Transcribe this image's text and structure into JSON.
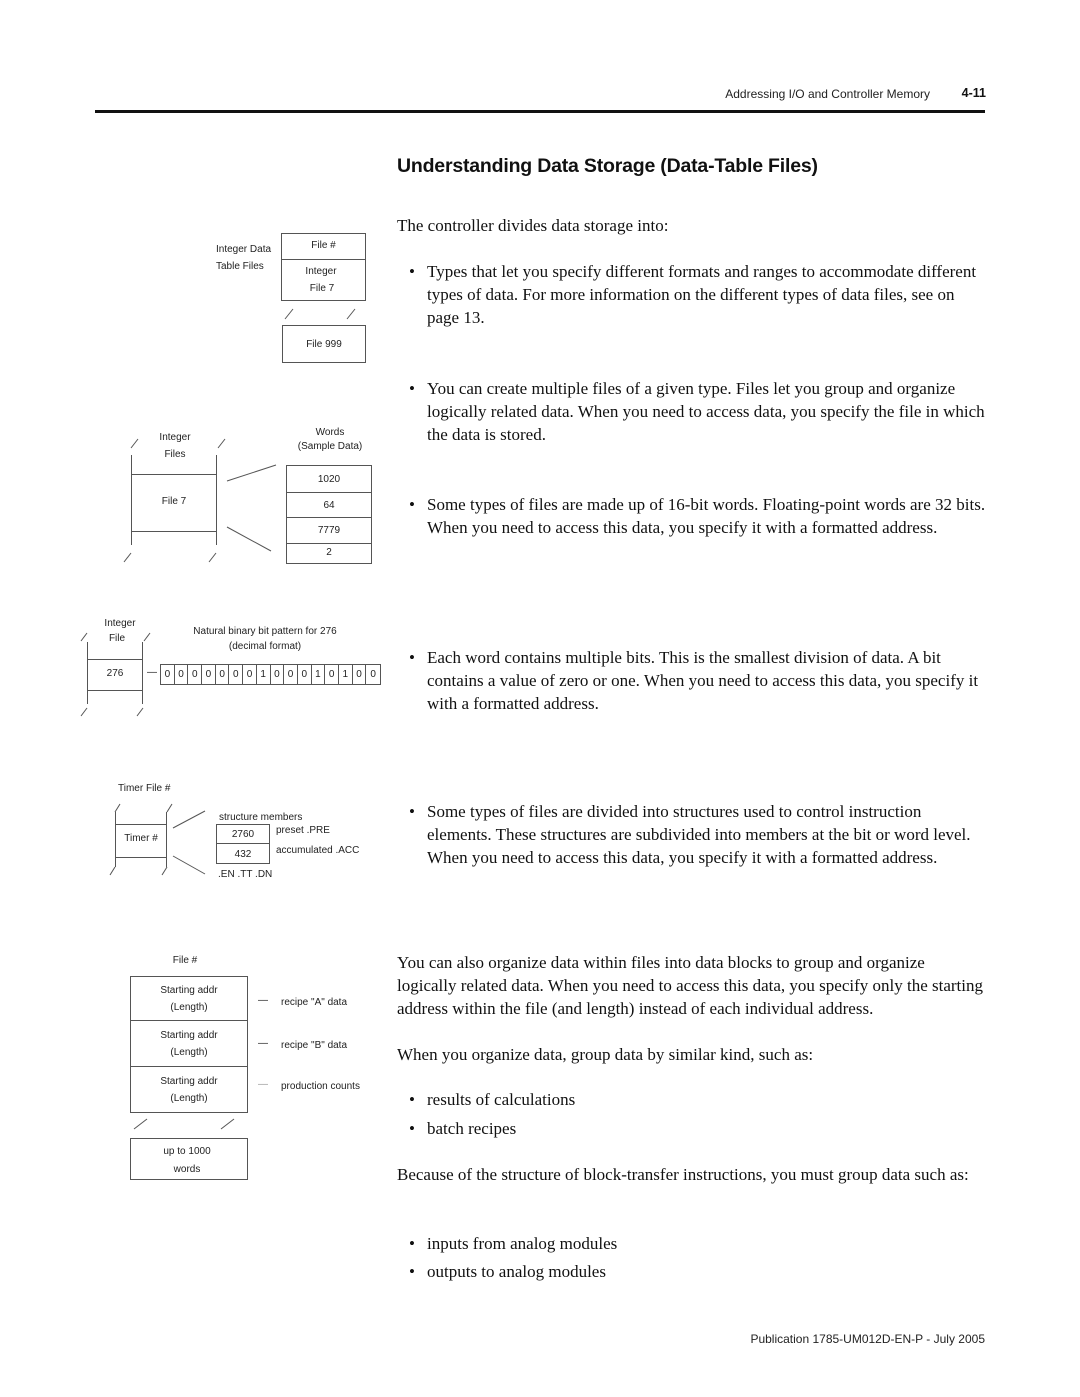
{
  "header": {
    "running_title": "Addressing I/O and Controller Memory",
    "page_number": "4-11"
  },
  "section": {
    "title": "Understanding Data Storage (Data-Table Files)"
  },
  "body": {
    "intro": "The controller divides data storage into:",
    "bullet_glyph": "•",
    "bullets": [
      "Types that let you specify different formats and ranges to accommodate different types of data. For more information on the different types of data files, see  on page 13.",
      "You can create multiple files of a given type.  Files let you group and organize logically related data.  When you need to access data, you specify the file in which the data is stored.",
      "Some types of files are made up of 16-bit words.  Floating-point words are 32 bits.  When you need to access this data, you specify it with a formatted address.",
      "Each word contains multiple bits.  This is the smallest division of data. A bit contains a value of zero or one.  When you need to access this data, you specify it with a formatted address.",
      "Some types of files are divided into structures used to control instruction elements.  These structures are subdivided into members at the bit or word level.  When you need to access this data, you specify it with a formatted address."
    ],
    "data_blocks_paragraph": "You can also organize data within files into data blocks to group and organize logically related data.  When you need to access this data, you specify only the starting address within the file (and length) instead of each individual address.",
    "group_paragraph": "When you organize data, group data by similar kind, such as:",
    "group_items": [
      "results of calculations",
      "batch recipes"
    ],
    "block_transfer_paragraph": "Because of the structure of block-transfer instructions, you must group data such as:",
    "block_transfer_items": [
      "inputs from analog modules",
      "outputs to analog modules"
    ]
  },
  "diagrams": {
    "data_table_files": {
      "label_line1": "Integer Data",
      "label_line2": "Table Files",
      "file_header": "File #",
      "file_line1": "Integer",
      "file_line2": "File 7",
      "last_file": "File 999"
    },
    "integer_files": {
      "label_line1": "Integer",
      "label_line2": "Files",
      "file": "File 7",
      "words_label_line1": "Words",
      "words_label_line2": "(Sample Data)",
      "words": [
        "1020",
        "64",
        "7779",
        "2"
      ]
    },
    "bit_pattern": {
      "label_line1": "Integer",
      "label_line2": "File",
      "value": "276",
      "caption_line1": "Natural binary bit pattern for 276",
      "caption_line2": "(decimal format)",
      "connector": "—",
      "bits": [
        "0",
        "0",
        "0",
        "0",
        "0",
        "0",
        "0",
        "1",
        "0",
        "0",
        "0",
        "1",
        "0",
        "1",
        "0",
        "0"
      ]
    },
    "timer": {
      "file_label": "Timer File #",
      "element": "Timer #",
      "members_label": "structure members",
      "preset_value": "2760",
      "preset_label": "preset  .PRE",
      "accum_value": "432",
      "accum_label": "accumulated  .ACC",
      "bits_label": ".EN .TT .DN"
    },
    "data_blocks": {
      "file_label": "File #",
      "blocks": [
        {
          "line1": "Starting addr",
          "line2": "(Length)",
          "label": "recipe \"A\" data"
        },
        {
          "line1": "Starting addr",
          "line2": "(Length)",
          "label": "recipe \"B\" data"
        },
        {
          "line1": "Starting addr",
          "line2": "(Length)",
          "label": "production counts"
        }
      ],
      "connector": "—",
      "limit_line1": "up to 1000",
      "limit_line2": "words"
    }
  },
  "footer": {
    "publication": "Publication 1785-UM012D-EN-P - July 2005"
  }
}
